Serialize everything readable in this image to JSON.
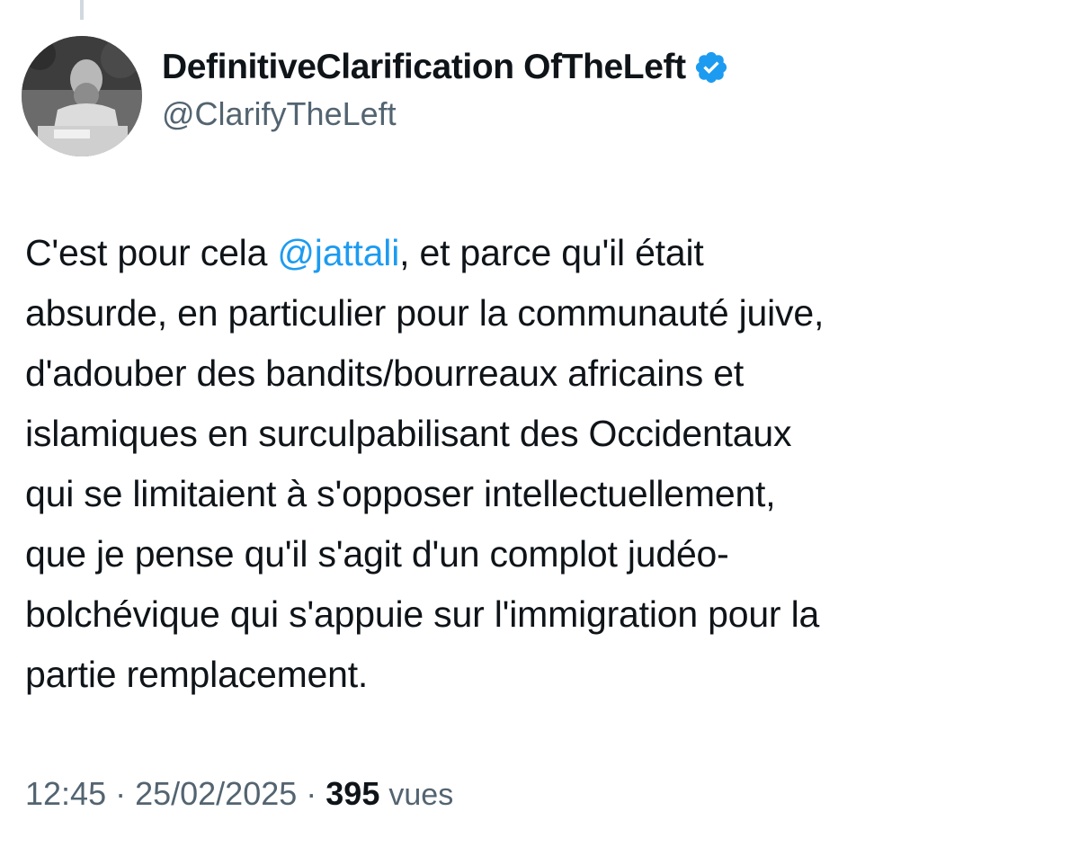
{
  "author": {
    "display_name": "DefinitiveClarification OfTheLeft",
    "handle": "@ClarifyTheLeft",
    "verified": true,
    "verified_color": "#1d9bf0"
  },
  "tweet": {
    "line1_before": "C'est pour cela ",
    "mention": "@jattali",
    "line1_after": ", et parce qu'il était",
    "line2": "absurde, en particulier pour la communauté juive,",
    "line3": "d'adouber des bandits/bourreaux africains et",
    "line4": "islamiques en surculpabilisant des Occidentaux",
    "line5": "qui se limitaient à s'opposer intellectuellement,",
    "line6": "que je pense qu'il s'agit d'un complot judéo-",
    "line7": "bolchévique qui s'appuie sur l'immigration pour la",
    "line8": "partie remplacement."
  },
  "meta": {
    "time": "12:45",
    "separator": " · ",
    "date": "25/02/2025",
    "views_count": "395",
    "views_label": "vues"
  },
  "colors": {
    "text": "#0f1419",
    "secondary": "#536471",
    "link": "#1d9bf0"
  }
}
